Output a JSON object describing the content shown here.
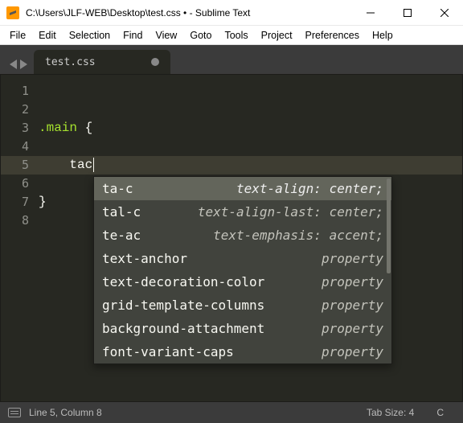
{
  "title": "C:\\Users\\JLF-WEB\\Desktop\\test.css • - Sublime Text",
  "menu": [
    "File",
    "Edit",
    "Selection",
    "Find",
    "View",
    "Goto",
    "Tools",
    "Project",
    "Preferences",
    "Help"
  ],
  "tab": {
    "name": "test.css",
    "dirty": true
  },
  "lines": [
    {
      "n": "1",
      "html": ""
    },
    {
      "n": "2",
      "html": ""
    },
    {
      "n": "3",
      "html": "<span class='tok-sel'>.main</span> <span class='tok-punc'>{</span>"
    },
    {
      "n": "4",
      "html": ""
    },
    {
      "n": "5",
      "html": "    <span class='tok-ident'>tac</span><span class='caret'></span>",
      "active": true
    },
    {
      "n": "6",
      "html": ""
    },
    {
      "n": "7",
      "html": "<span class='tok-punc'>}</span>"
    },
    {
      "n": "8",
      "html": ""
    }
  ],
  "autocomplete": [
    {
      "t": "ta-c",
      "h": "text-align: center;",
      "sel": true
    },
    {
      "t": "tal-c",
      "h": "text-align-last: center;"
    },
    {
      "t": "te-ac",
      "h": "text-emphasis: accent;"
    },
    {
      "t": "text-anchor",
      "h": "property"
    },
    {
      "t": "text-decoration-color",
      "h": "property"
    },
    {
      "t": "grid-template-columns",
      "h": "property"
    },
    {
      "t": "background-attachment",
      "h": "property"
    },
    {
      "t": "font-variant-caps",
      "h": "property"
    }
  ],
  "status": {
    "pos": "Line 5, Column 8",
    "tab": "Tab Size: 4",
    "lang": "C"
  }
}
